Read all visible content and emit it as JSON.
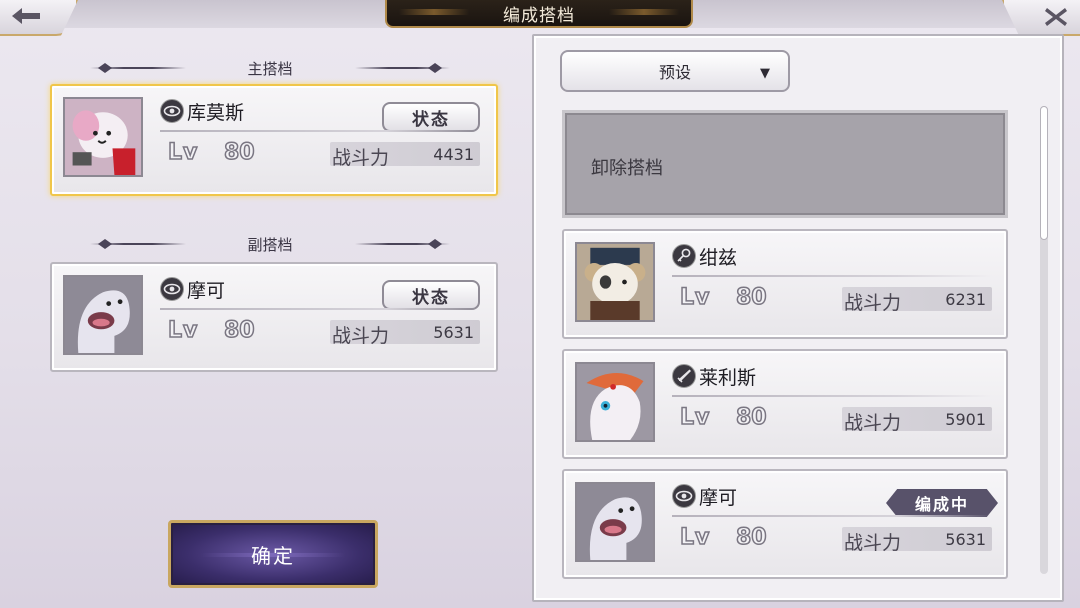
{
  "header": {
    "title": "编成搭档",
    "back_icon": "arrow-left-icon",
    "close_icon": "close-icon"
  },
  "main_partner": {
    "heading": "主搭档",
    "name": "库莫斯",
    "role_icon": "eye-icon",
    "lv_label": "Lv",
    "level": "80",
    "power_label": "战斗力",
    "power": "4431",
    "status_label": "状态"
  },
  "sub_partner": {
    "heading": "副搭档",
    "name": "摩可",
    "role_icon": "eye-icon",
    "lv_label": "Lv",
    "level": "80",
    "power_label": "战斗力",
    "power": "5631",
    "status_label": "状态"
  },
  "confirm_label": "确定",
  "preset": {
    "label": "预设",
    "arrow": "▼"
  },
  "remove_label": "卸除搭档",
  "partner_list": [
    {
      "name": "绀兹",
      "role_icon": "key-icon",
      "lv_label": "Lv",
      "level": "80",
      "power_label": "战斗力",
      "power": "6231"
    },
    {
      "name": "莱利斯",
      "role_icon": "sword-icon",
      "lv_label": "Lv",
      "level": "80",
      "power_label": "战斗力",
      "power": "5901"
    },
    {
      "name": "摩可",
      "role_icon": "eye-icon",
      "lv_label": "Lv",
      "level": "80",
      "power_label": "战斗力",
      "power": "5631",
      "badge": "编成中"
    }
  ],
  "colors": {
    "selected_border": "#f0c64a",
    "confirm_bg": "#3b2e6b",
    "badge_bg": "#58526a"
  }
}
